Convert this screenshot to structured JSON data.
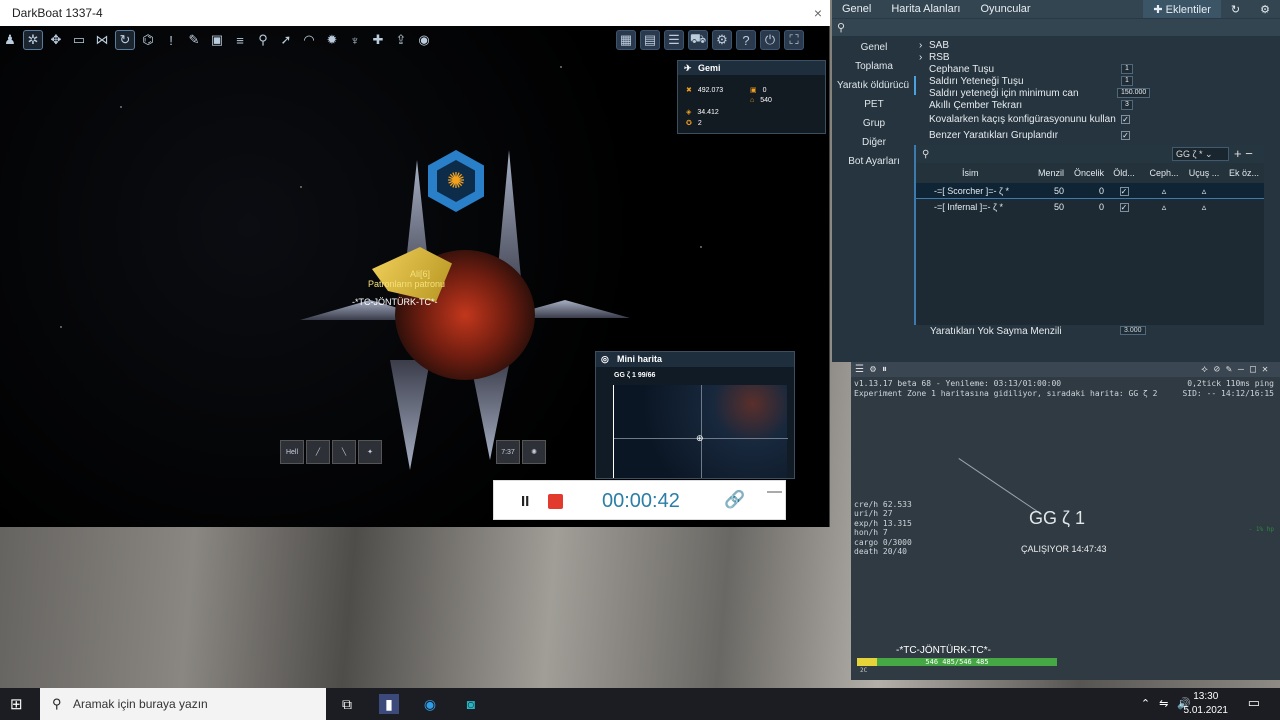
{
  "window": {
    "title": "DarkBoat 1337-4",
    "close": "×"
  },
  "toolbar": {
    "left_icons": [
      "people-icon",
      "settings-icon",
      "target-icon",
      "monitor-icon",
      "group-icon",
      "loop-icon",
      "diagram-icon",
      "alert-icon",
      "tools-icon",
      "photo-icon",
      "list-icon",
      "pin-icon",
      "rocket-icon",
      "arc-icon",
      "creature-icon",
      "wings-icon",
      "puzzle-icon",
      "upload-icon",
      "toggle-icon"
    ],
    "right_icons": [
      "box-icon",
      "window-icon",
      "list-alert-icon",
      "cart-icon",
      "gear-icon",
      "help-icon",
      "power-icon",
      "fullscreen-icon"
    ]
  },
  "ship_tags": {
    "clan": "Patronların patronu",
    "name": "-*TC-JÖNTÜRK-TC*-",
    "small": "Ali[6]"
  },
  "gemi": {
    "title": "Gemi",
    "credits": "492.073",
    "uridium": "34.412",
    "other1": "2",
    "cargo": "0",
    "ammo": "540"
  },
  "minimap": {
    "title": "Mini harita",
    "location": "GG ζ 1 99/66"
  },
  "skills": {
    "cooldown": "7:37",
    "slot1": "Hell"
  },
  "recorder": {
    "time": "00:00:42",
    "pause": "II",
    "link": "🔗",
    "min": "—"
  },
  "panel": {
    "tabs": [
      "Genel",
      "Harita Alanları",
      "Oyuncular"
    ],
    "plugins": "Eklentiler",
    "sidebar": [
      "Genel",
      "Toplama",
      "Yaratık öldürücü",
      "PET",
      "Grup",
      "Diğer",
      "Bot Ayarları"
    ],
    "options": {
      "sab": "SAB",
      "rsb": "RSB",
      "ammo_key": "Cephane Tuşu",
      "ammo_val": "1",
      "ability_key": "Saldırı Yeteneği Tuşu",
      "ability_val": "1",
      "ability_min": "Saldırı yeteneği için minimum can",
      "ability_min_val": "150.000",
      "smart_circle": "Akıllı Çember Tekrarı",
      "smart_val": "3",
      "flee": "Kovalarken kaçış konfigürasyonunu kullan",
      "group": "Benzer Yaratıkları Gruplandır"
    },
    "filter": "GG ζ *",
    "table": {
      "headers": [
        "İsim",
        "Menzil",
        "Öncelik",
        "Öld...",
        "Ceph...",
        "Uçuş ...",
        "Ek öz..."
      ],
      "rows": [
        {
          "name": "-=[ Scorcher ]=- ζ *",
          "range": "50",
          "priority": "0"
        },
        {
          "name": "-=[ Infernal ]=- ζ *",
          "range": "50",
          "priority": "0"
        }
      ]
    },
    "ignore_label": "Yaratıkları Yok Sayma Menzili",
    "ignore_val": "3.000"
  },
  "log": {
    "line1": "v1.13.17 beta 68 - Yenileme: 03:13/01:00:00",
    "line1r": "0,2tick 110ms ping",
    "line2": "Experiment Zone 1 haritasına gidiliyor, sıradaki harita: GG ζ 2",
    "line2r": "SID: -- 14:12/16:15",
    "stats": [
      "cre/h 62.533",
      "uri/h 27",
      "exp/h 13.315",
      "hon/h 7",
      "cargo 0/3000",
      "death 20/40"
    ],
    "map": "GG ζ 1",
    "status": "ÇALIŞIYOR 14:47:43",
    "nick": "-*TC-JÖNTÜRK-TC*-",
    "hp": "546 485/546 485",
    "hp2": "2C",
    "side": "- 1% hp"
  },
  "taskbar": {
    "search": "Aramak için buraya yazın",
    "time": "13:30",
    "date": "5.01.2021"
  }
}
